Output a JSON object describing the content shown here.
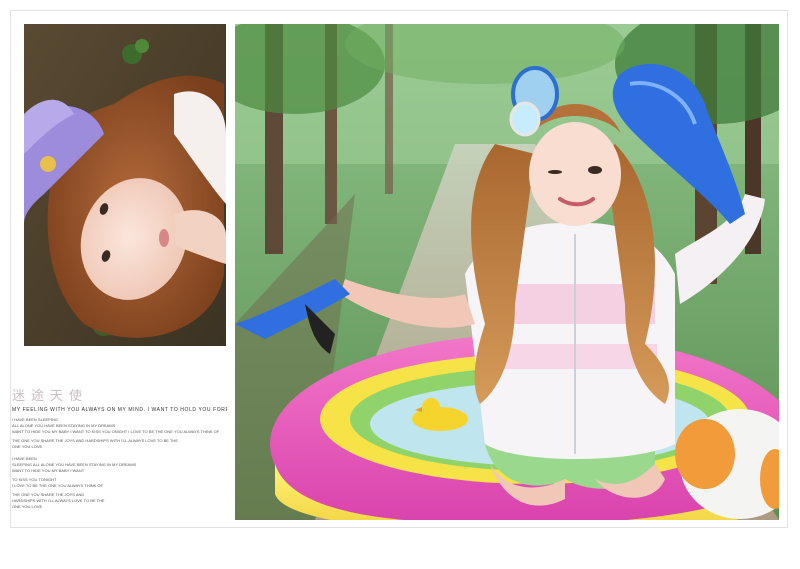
{
  "layout": {
    "title_cn": "迷途天使",
    "subtitle": "MY FEELING WITH YOU ALWAYS ON MY MIND. I WANT TO HOLD YOU FOREVER",
    "lyrics_block1": [
      "I HAVE BEEN SLEEPING",
      "ALL ALONE YOU HAVE BEEN STAYING IN MY DREAMS",
      "WANT TO HIDE YOU MY BABY I WANT TO KISS YOU ONIGHT I LOVE TO BE THE ONE YOU ALWAYS THINK OF",
      "",
      "THE ONE YOU SHARE THE JOYS AND HARDSHIPS WITH I'LL ALWAYS LOVE TO BE THE",
      "ONE YOU LOVE"
    ],
    "lyrics_block2": [
      "I HAVE BEEN",
      "SLEEPING ALL ALONE YOU HAVE BEEN STAYING IN MY DREAMS",
      "WANT TO HIDE YOU MY BABY I WANT",
      "",
      "TO KISS YOU TONIGHT",
      "I LOVE TO BE THE ONE YOU ALWAYS THINK OF",
      "",
      "THE ONE YOU SHARE THE JOYS AND",
      "HARDSHIPS WITH I'LL ALWAYS LOVE TO BE THE",
      "ONE YOU LOVE"
    ]
  },
  "colors": {
    "title": "#c9bdc3",
    "pool_pink": "#e84fb8",
    "pool_yellow": "#f7e43a",
    "pool_green": "#8fd36a",
    "flipper_blue": "#2f6fe0",
    "forest_green": "#3f7c3a"
  }
}
